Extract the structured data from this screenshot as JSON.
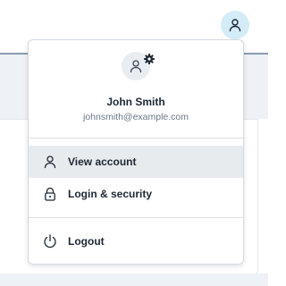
{
  "user": {
    "name": "John Smith",
    "email": "johnsmith@example.com"
  },
  "menu": {
    "items": [
      {
        "label": "View account",
        "icon": "user-icon",
        "active": true
      },
      {
        "label": "Login & security",
        "icon": "lock-icon",
        "active": false
      },
      {
        "label": "Logout",
        "icon": "power-icon",
        "active": false
      }
    ]
  },
  "colors": {
    "avatar_button_bg": "#d4ecf8",
    "active_item_bg": "#e8ebee",
    "text_primary": "#1d2733",
    "text_secondary": "#6c7886"
  }
}
